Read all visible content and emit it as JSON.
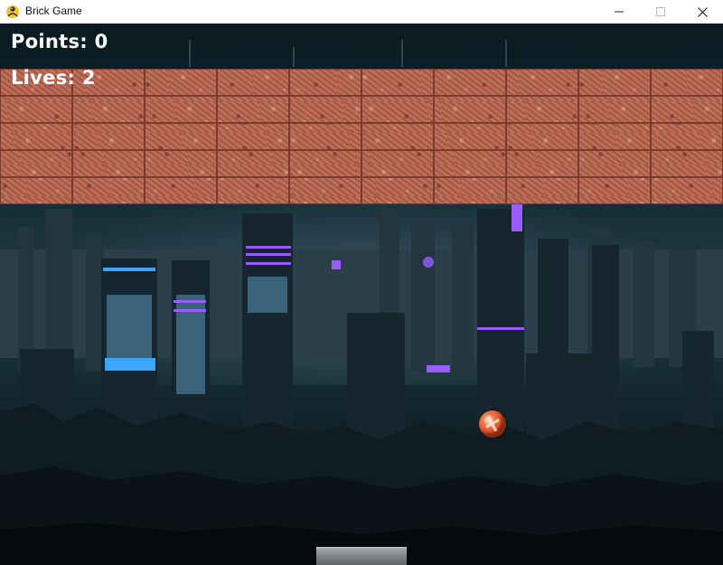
{
  "window": {
    "title": "Brick Game",
    "minimize_glyph": "—",
    "maximize_glyph": "☐",
    "close_glyph": "✕",
    "icon": "python-snake-icon"
  },
  "hud": {
    "points": "Points: 0",
    "lives": "Lives: 2"
  },
  "bricks": {
    "rows": 5,
    "columns": 10,
    "color": "#ad5f4b"
  },
  "ball": {
    "color": "#e0602f",
    "icon": "ball-icon"
  },
  "paddle": {
    "color": "#8a8e92"
  },
  "colors": {
    "neon_purple": "#9b5cff",
    "neon_blue": "#3aa6ff"
  }
}
